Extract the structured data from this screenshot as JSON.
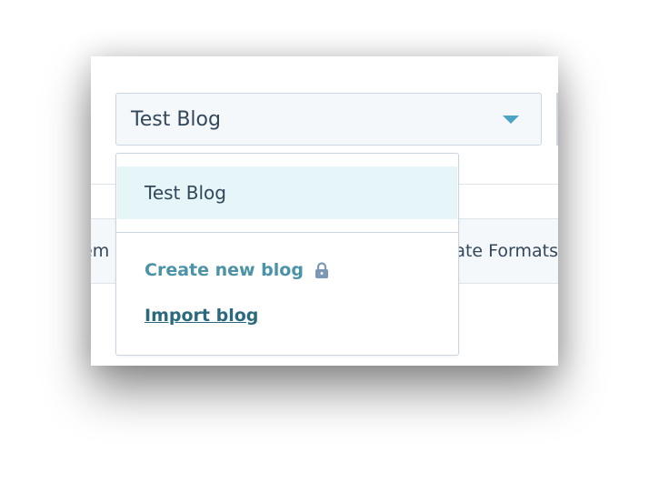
{
  "blog_select": {
    "value": "Test Blog"
  },
  "tabs": {
    "left_partial": "em",
    "right_partial": "ate Formats"
  },
  "dropdown": {
    "options": [
      {
        "label": "Test Blog",
        "selected": true
      }
    ],
    "actions": {
      "create_label": "Create new blog",
      "create_icon": "lock-icon",
      "import_label": "Import blog"
    }
  },
  "colors": {
    "link": "#4b93a6",
    "link_dark": "#2b6a7c",
    "caret": "#4ba3c7",
    "selected_bg": "#e5f5f8",
    "lock": "#7c98b6"
  }
}
